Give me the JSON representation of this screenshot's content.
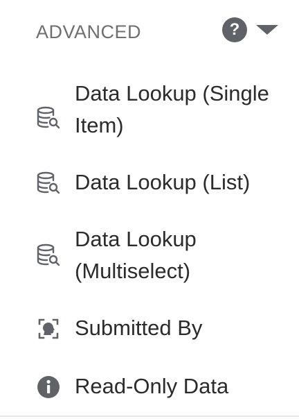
{
  "section": {
    "title": "ADVANCED",
    "help_icon_glyph": "?",
    "help_icon": "help-circle-icon",
    "toggle_icon": "caret-down-icon"
  },
  "items": [
    {
      "label": "Data Lookup (Single Item)",
      "icon": "database-search-icon"
    },
    {
      "label": "Data Lookup (List)",
      "icon": "database-search-icon"
    },
    {
      "label": "Data Lookup (Multiselect)",
      "icon": "database-search-icon"
    },
    {
      "label": "Submitted By",
      "icon": "person-scan-icon"
    },
    {
      "label": "Read-Only Data",
      "icon": "info-icon"
    }
  ],
  "colors": {
    "text": "#2b2b2b",
    "header_text": "#6f6f6f",
    "icon": "#5f6368",
    "divider": "#e6e6e6"
  }
}
